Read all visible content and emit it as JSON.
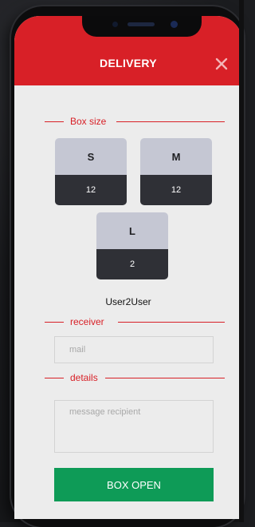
{
  "header": {
    "title": "DELIVERY",
    "close_icon": "close-icon",
    "accent_color": "#d82027"
  },
  "box_size": {
    "section_label": "Box size",
    "boxes": [
      {
        "size": "S",
        "count": "12"
      },
      {
        "size": "M",
        "count": "12"
      },
      {
        "size": "L",
        "count": "2"
      }
    ]
  },
  "user": {
    "name": "User2User"
  },
  "receiver": {
    "section_label": "receiver",
    "placeholder": "mail"
  },
  "details": {
    "section_label": "details",
    "placeholder": "message recipient"
  },
  "actions": {
    "open_label": "BOX OPEN",
    "open_color": "#0e9b57"
  }
}
